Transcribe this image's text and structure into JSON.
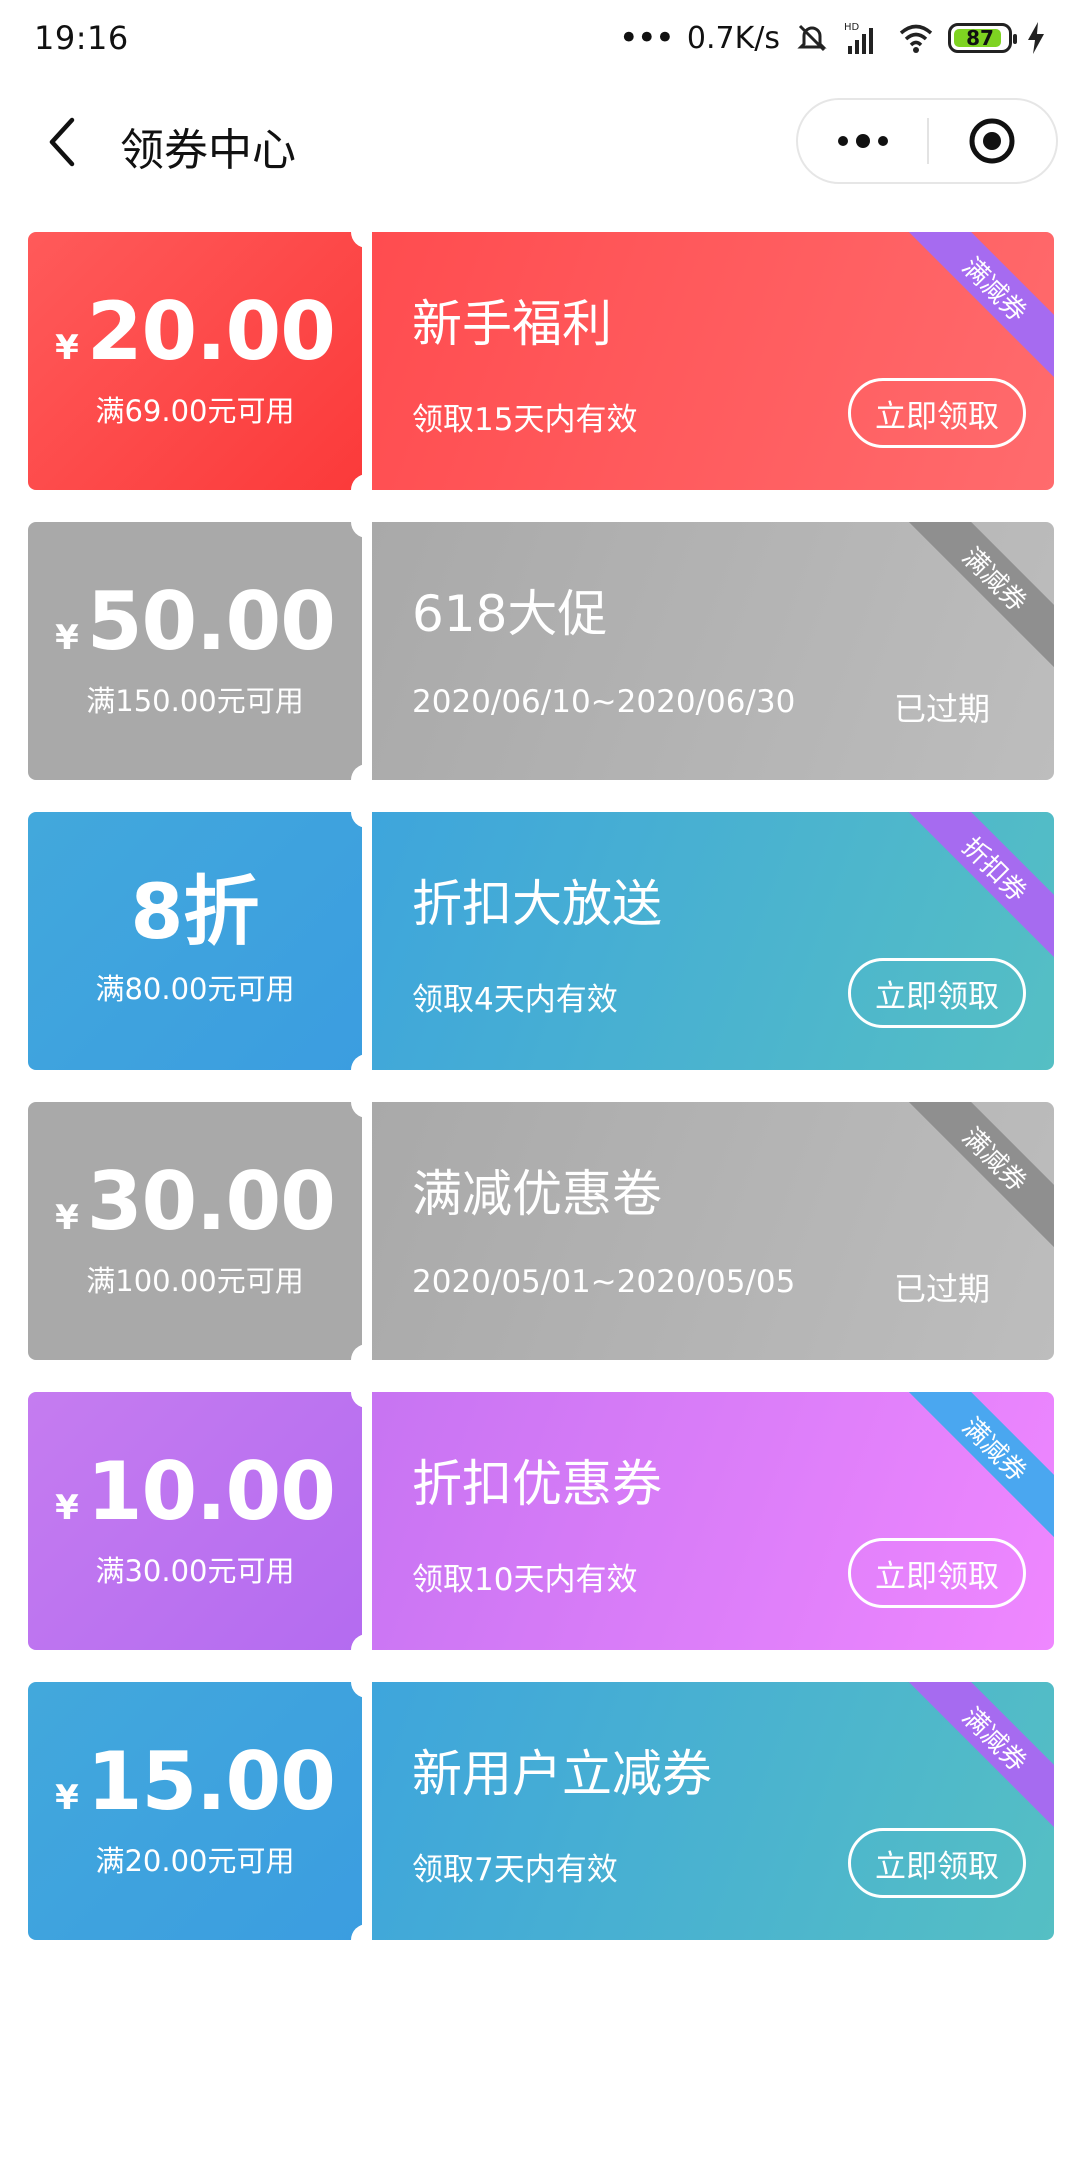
{
  "status_bar": {
    "time": "19:16",
    "network_speed": "0.7K/s",
    "battery": "87",
    "icons": [
      "dots-icon",
      "mute-bell-icon",
      "hd-signal-icon",
      "wifi-icon",
      "battery-icon",
      "charging-icon"
    ]
  },
  "nav": {
    "title": "领券中心",
    "back_icon": "chevron-left-icon",
    "more_icon": "more-dots-icon",
    "close_icon": "target-close-icon"
  },
  "colors": {
    "red": "#ff4c4f",
    "grey": "#a9a9a9",
    "blue": "#3ea5dc",
    "purple": "#c774f2",
    "ribbon_purple": "#a66bf0",
    "ribbon_grey": "#8f8f8f",
    "ribbon_blue": "#4aa7f0"
  },
  "coupons": [
    {
      "theme": "red",
      "currency": "¥",
      "amount": "20.00",
      "condition": "满69.00元可用",
      "title": "新手福利",
      "subtitle": "领取15天内有效",
      "action": "立即领取",
      "tag": "满减券",
      "tag_color": "#a66bf0"
    },
    {
      "theme": "grey",
      "currency": "¥",
      "amount": "50.00",
      "condition": "满150.00元可用",
      "title": "618大促",
      "subtitle": "2020/06/10~2020/06/30",
      "status": "已过期",
      "tag": "满减券",
      "tag_color": "#8f8f8f"
    },
    {
      "theme": "blue",
      "discount": "8折",
      "condition": "满80.00元可用",
      "title": "折扣大放送",
      "subtitle": "领取4天内有效",
      "action": "立即领取",
      "tag": "折扣券",
      "tag_color": "#a66bf0"
    },
    {
      "theme": "grey",
      "currency": "¥",
      "amount": "30.00",
      "condition": "满100.00元可用",
      "title": "满减优惠卷",
      "subtitle": "2020/05/01~2020/05/05",
      "status": "已过期",
      "tag": "满减券",
      "tag_color": "#8f8f8f"
    },
    {
      "theme": "purple",
      "currency": "¥",
      "amount": "10.00",
      "condition": "满30.00元可用",
      "title": "折扣优惠券",
      "subtitle": "领取10天内有效",
      "action": "立即领取",
      "tag": "满减券",
      "tag_color": "#4aa7f0"
    },
    {
      "theme": "blue",
      "currency": "¥",
      "amount": "15.00",
      "condition": "满20.00元可用",
      "title": "新用户立减券",
      "subtitle": "领取7天内有效",
      "action": "立即领取",
      "tag": "满减券",
      "tag_color": "#a66bf0"
    }
  ]
}
